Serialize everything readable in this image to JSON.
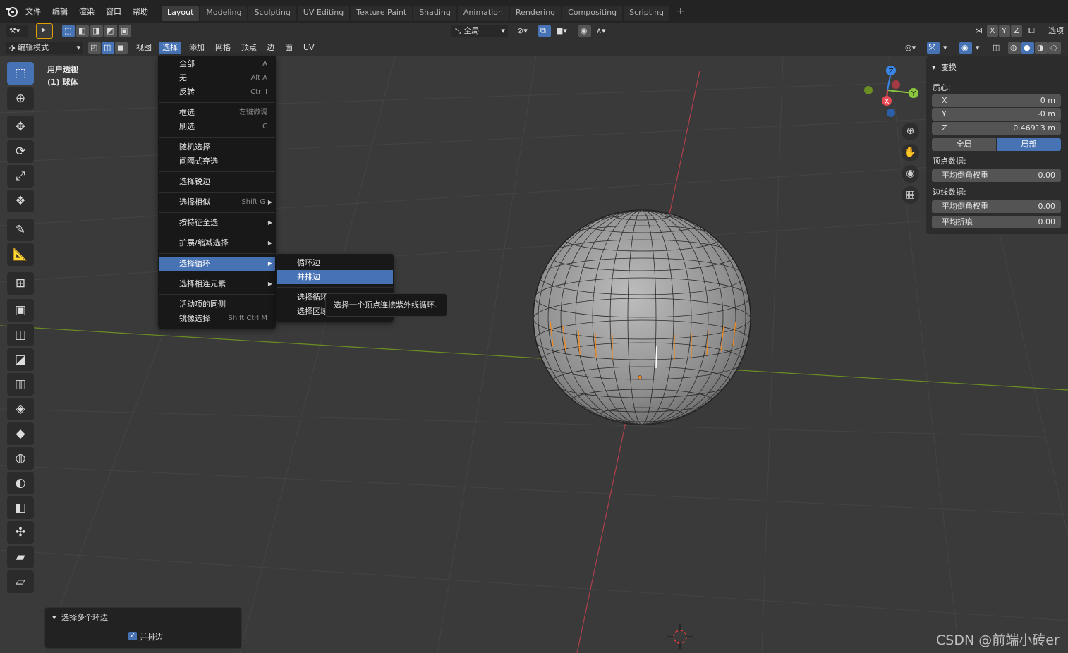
{
  "menubar": [
    "文件",
    "编辑",
    "渲染",
    "窗口",
    "帮助"
  ],
  "workspaces": [
    "Layout",
    "Modeling",
    "Sculpting",
    "UV Editing",
    "Texture Paint",
    "Shading",
    "Animation",
    "Rendering",
    "Compositing",
    "Scripting",
    "+"
  ],
  "header1": {
    "orientation": "全局",
    "axis_x": "X",
    "axis_y": "Y",
    "axis_z": "Z",
    "options": "选项"
  },
  "header2": {
    "mode": "编辑模式",
    "menus": [
      "视图",
      "选择",
      "添加",
      "网格",
      "顶点",
      "边",
      "面",
      "UV"
    ]
  },
  "viewport_info": {
    "view": "用户透视",
    "object": "(1) 球体"
  },
  "select_menu": [
    {
      "label": "全部",
      "shortcut": "A"
    },
    {
      "label": "无",
      "shortcut": "Alt A"
    },
    {
      "label": "反转",
      "shortcut": "Ctrl I"
    },
    {
      "label": "框选",
      "shortcut": "左键微调"
    },
    {
      "label": "刷选",
      "shortcut": "C"
    },
    {
      "label": "随机选择",
      "shortcut": ""
    },
    {
      "label": "间隔式弃选",
      "shortcut": ""
    },
    {
      "label": "选择锐边",
      "shortcut": ""
    },
    {
      "label": "选择相似",
      "shortcut": "Shift G"
    },
    {
      "label": "按特征全选",
      "shortcut": ""
    },
    {
      "label": "扩展/缩减选择",
      "shortcut": ""
    },
    {
      "label": "选择循环",
      "shortcut": ""
    },
    {
      "label": "选择相连元素",
      "shortcut": ""
    },
    {
      "label": "活动项的同侧",
      "shortcut": ""
    },
    {
      "label": "镜像选择",
      "shortcut": "Shift Ctrl M"
    }
  ],
  "loop_submenu": [
    "循环边",
    "并排边",
    "选择循环",
    "选择区域"
  ],
  "tooltip": "选择一个顶点连接紫外线循环.",
  "npanel": {
    "title": "变换",
    "median_label": "质心:",
    "x_label": "X",
    "x_value": "0 m",
    "y_label": "Y",
    "y_value": "-0 m",
    "z_label": "Z",
    "z_value": "0.46913 m",
    "global": "全局",
    "local": "局部",
    "vertex_data": "顶点数据:",
    "vertex_bevel_label": "平均倒角权重",
    "vertex_bevel_value": "0.00",
    "edge_data": "边线数据:",
    "edge_bevel_label": "平均倒角权重",
    "edge_bevel_value": "0.00",
    "crease_label": "平均折痕",
    "crease_value": "0.00"
  },
  "gizmo": {
    "x": "X",
    "y": "Y",
    "z": "Z"
  },
  "operator_panel": {
    "title": "选择多个环边",
    "checkbox_label": "并排边",
    "checked": true
  },
  "watermark": "CSDN @前端小砖er",
  "colors": {
    "accent": "#4772b3",
    "selected_edge": "#f08a24",
    "x_axis": "#e84a55",
    "y_axis": "#8cc63f",
    "z_axis": "#3a86e8"
  }
}
